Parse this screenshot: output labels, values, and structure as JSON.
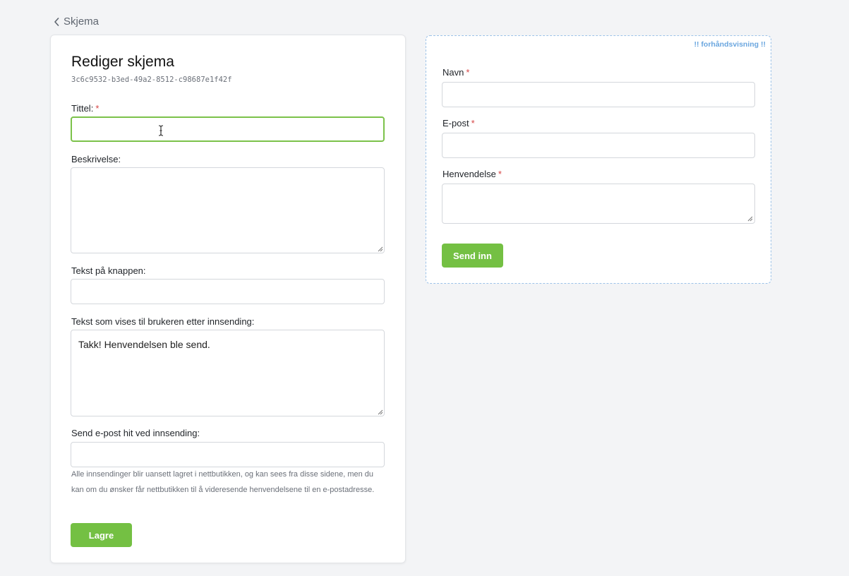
{
  "breadcrumb": {
    "label": "Skjema"
  },
  "editor": {
    "title": "Rediger skjema",
    "form_id": "3c6c9532-b3ed-49a2-8512-c98687e1f42f",
    "fields": {
      "title_label": "Tittel:",
      "title_value": "",
      "description_label": "Beskrivelse:",
      "description_value": "",
      "button_text_label": "Tekst på knappen:",
      "button_text_value": "",
      "after_submit_label": "Tekst som vises til brukeren etter innsending:",
      "after_submit_value": "Takk! Henvendelsen ble send.",
      "email_label": "Send e-post hit ved innsending:",
      "email_value": ""
    },
    "required_marker": "*",
    "help_text": "Alle innsendinger blir uansett lagret i nettbutikken, og kan sees fra disse sidene, men du kan om du ønsker får nettbutikken til å videresende henvendelsene til en e-postadresse.",
    "save_label": "Lagre"
  },
  "preview": {
    "badge": "!! forhåndsvisning !!",
    "fields": [
      {
        "label": "Navn",
        "required": "*"
      },
      {
        "label": "E-post",
        "required": "*"
      },
      {
        "label": "Henvendelse",
        "required": "*"
      }
    ],
    "submit_label": "Send inn"
  },
  "colors": {
    "accent": "#74c043",
    "focus_border": "#7cc24a",
    "required": "#d64545",
    "preview_border": "#9cc2e8",
    "preview_badge": "#6aa6df"
  },
  "icons": {
    "breadcrumb_back": "chevron-left-icon",
    "text_cursor": "text-cursor-icon",
    "resize": "resize-handle-icon"
  }
}
